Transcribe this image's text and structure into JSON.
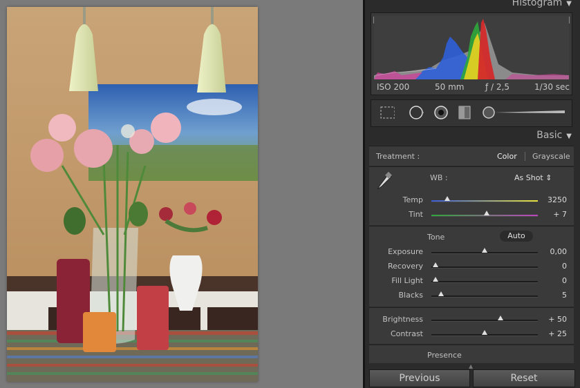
{
  "histogram": {
    "title": "Histogram",
    "iso": "ISO 200",
    "focal": "50 mm",
    "aperture": "ƒ / 2,5",
    "shutter": "1/30 sec"
  },
  "basic": {
    "title": "Basic",
    "treatment_label": "Treatment :",
    "color_label": "Color",
    "grayscale_label": "Grayscale",
    "wb_label": "WB :",
    "wb_value": "As Shot ⇕",
    "temp_label": "Temp",
    "temp_value": "3250",
    "temp_level": 0.15,
    "tint_label": "Tint",
    "tint_value": "+ 7",
    "tint_level": 0.52,
    "tone_label": "Tone",
    "auto_label": "Auto",
    "sliders": [
      {
        "label": "Exposure",
        "value": "0,00",
        "level": 0.5
      },
      {
        "label": "Recovery",
        "value": "0",
        "level": 0.04
      },
      {
        "label": "Fill Light",
        "value": "0",
        "level": 0.04
      },
      {
        "label": "Blacks",
        "value": "5",
        "level": 0.09
      }
    ],
    "brightness_label": "Brightness",
    "brightness_value": "+ 50",
    "brightness_level": 0.65,
    "contrast_label": "Contrast",
    "contrast_value": "+ 25",
    "contrast_level": 0.5,
    "presence_label": "Presence"
  },
  "footer": {
    "previous_label": "Previous",
    "reset_label": "Reset"
  },
  "colors": {
    "panel_bg": "#2b2b2b",
    "box_bg": "#3a3a3a",
    "thumb": "#e0e0e0"
  }
}
